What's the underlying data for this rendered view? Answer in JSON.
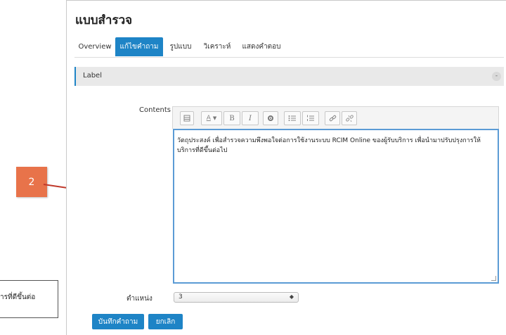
{
  "page": {
    "title": "แบบสำรวจ"
  },
  "tabs": [
    {
      "label": "Overview",
      "active": false
    },
    {
      "label": "แก้ไขคำถาม",
      "active": true
    },
    {
      "label": "รูปแบบ",
      "active": false
    },
    {
      "label": "วิเคราะห์",
      "active": false
    },
    {
      "label": "แสดงคำตอบ",
      "active": false
    }
  ],
  "section": {
    "label": "Label",
    "collapse_glyph": "-"
  },
  "form": {
    "contents_label": "Contents",
    "contents_text": "วัตถุประสงค์ เพื่อสำรวจความพึงพอใจต่อการใช้งานระบบ RCIM Online ของผู้รับบริการ เพื่อนำมาปรับปรุงการให้บริการที่ดีขึ้นต่อไป",
    "position_label": "ตำแหน่ง",
    "position_value": "3"
  },
  "toolbar": {
    "bold": "B",
    "italic": "I",
    "icons": [
      "collapse-icon",
      "font-color-icon",
      "bold-icon",
      "italic-icon",
      "settings-icon",
      "bullet-list-icon",
      "numbered-list-icon",
      "link-icon",
      "unlink-icon"
    ]
  },
  "buttons": {
    "save": "บันทึกคำถาม",
    "cancel": "ยกเลิก"
  },
  "annotation": {
    "step_number": "2",
    "snippet_text": "การที่ดีขึ้นต่อ",
    "colors": {
      "callout": "#e8734a",
      "arrow": "#c0392b",
      "accent": "#1e84c6"
    }
  }
}
